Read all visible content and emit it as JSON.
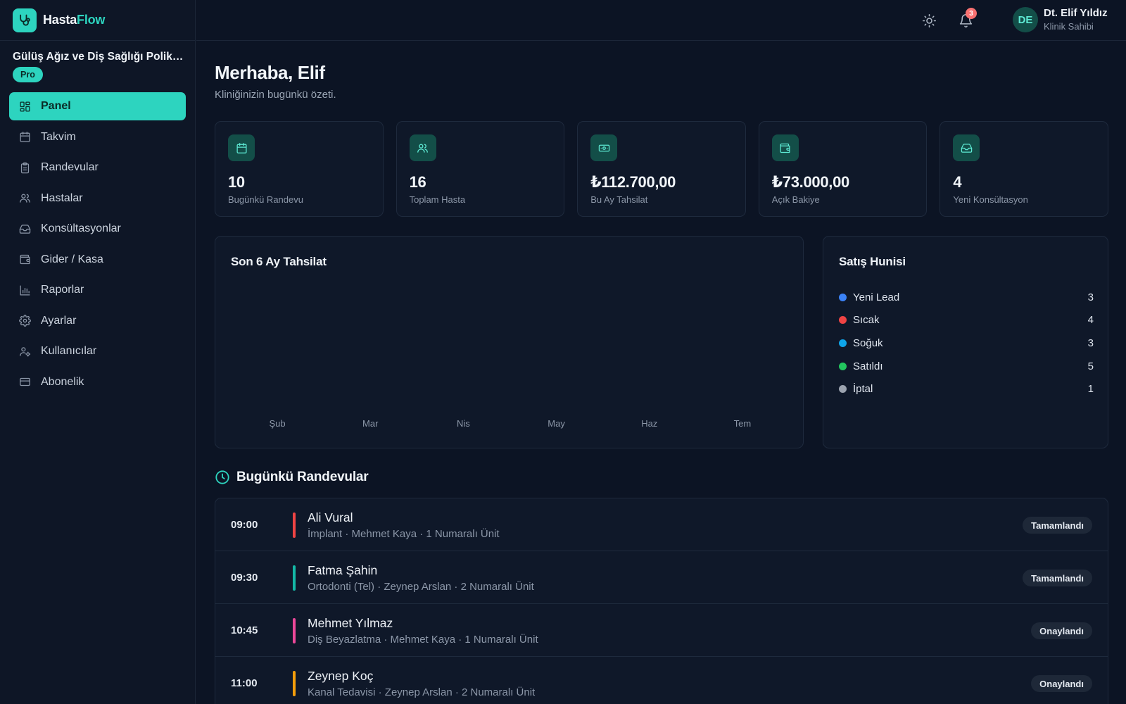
{
  "brand": {
    "name_part1": "Hasta",
    "name_part2": "Flow"
  },
  "clinic": {
    "name": "Gülüş Ağız ve Diş Sağlığı Polikliniği",
    "plan": "Pro"
  },
  "nav": [
    {
      "label": "Panel",
      "icon": "dashboard-icon",
      "active": true
    },
    {
      "label": "Takvim",
      "icon": "calendar-icon"
    },
    {
      "label": "Randevular",
      "icon": "clipboard-icon"
    },
    {
      "label": "Hastalar",
      "icon": "users-icon"
    },
    {
      "label": "Konsültasyonlar",
      "icon": "inbox-icon"
    },
    {
      "label": "Gider / Kasa",
      "icon": "wallet-icon"
    },
    {
      "label": "Raporlar",
      "icon": "bar-chart-icon"
    },
    {
      "label": "Ayarlar",
      "icon": "gear-icon"
    },
    {
      "label": "Kullanıcılar",
      "icon": "user-cog-icon"
    },
    {
      "label": "Abonelik",
      "icon": "credit-card-icon"
    }
  ],
  "header": {
    "notification_count": "3",
    "user": {
      "initials": "DE",
      "name": "Dt. Elif Yıldız",
      "role": "Klinik Sahibi"
    }
  },
  "main": {
    "greeting": "Merhaba, Elif",
    "subtitle": "Kliniğinizin bugünkü özeti."
  },
  "stats": [
    {
      "value": "10",
      "label": "Bugünkü Randevu",
      "icon": "calendar-icon"
    },
    {
      "value": "16",
      "label": "Toplam Hasta",
      "icon": "users-icon"
    },
    {
      "value": "₺112.700,00",
      "label": "Bu Ay Tahsilat",
      "icon": "banknote-icon"
    },
    {
      "value": "₺73.000,00",
      "label": "Açık Bakiye",
      "icon": "wallet-icon"
    },
    {
      "value": "4",
      "label": "Yeni Konsültasyon",
      "icon": "inbox-icon"
    }
  ],
  "chart_data": {
    "type": "bar",
    "title": "Son 6 Ay Tahsilat",
    "categories": [
      "Şub",
      "Mar",
      "Nis",
      "May",
      "Haz",
      "Tem"
    ],
    "values": [
      0,
      0,
      0,
      0,
      0,
      0
    ]
  },
  "funnel": {
    "title": "Satış Hunisi",
    "items": [
      {
        "name": "Yeni Lead",
        "count": "3",
        "color": "#3b82f6"
      },
      {
        "name": "Sıcak",
        "count": "4",
        "color": "#ef4444"
      },
      {
        "name": "Soğuk",
        "count": "3",
        "color": "#0ea5e9"
      },
      {
        "name": "Satıldı",
        "count": "5",
        "color": "#22c55e"
      },
      {
        "name": "İptal",
        "count": "1",
        "color": "#9ca3af"
      }
    ]
  },
  "appointments": {
    "title": "Bugünkü Randevular",
    "items": [
      {
        "time": "09:00",
        "patient": "Ali Vural",
        "detail": "İmplant · Mehmet Kaya · 1 Numaralı Ünit",
        "status": "Tamamlandı",
        "color": "#ef4444"
      },
      {
        "time": "09:30",
        "patient": "Fatma Şahin",
        "detail": "Ortodonti (Tel) · Zeynep Arslan · 2 Numaralı Ünit",
        "status": "Tamamlandı",
        "color": "#14b8a6"
      },
      {
        "time": "10:45",
        "patient": "Mehmet Yılmaz",
        "detail": "Diş Beyazlatma · Mehmet Kaya · 1 Numaralı Ünit",
        "status": "Onaylandı",
        "color": "#ec4899"
      },
      {
        "time": "11:00",
        "patient": "Zeynep Koç",
        "detail": "Kanal Tedavisi · Zeynep Arslan · 2 Numaralı Ünit",
        "status": "Onaylandı",
        "color": "#f59e0b"
      }
    ]
  }
}
